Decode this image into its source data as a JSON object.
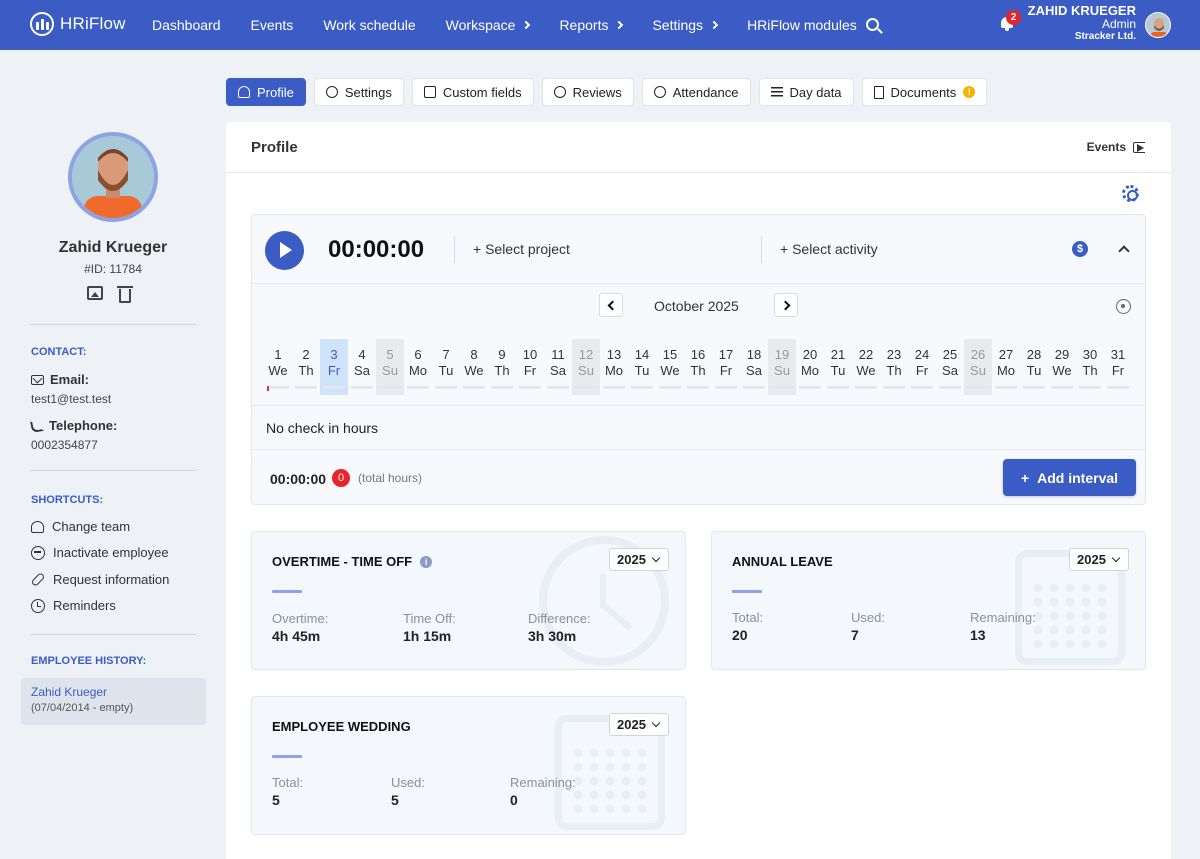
{
  "app": {
    "logo_text": "HRiFlow",
    "nav": [
      {
        "label": "Dashboard",
        "chevron": false
      },
      {
        "label": "Events",
        "chevron": false
      },
      {
        "label": "Work schedule",
        "chevron": false
      },
      {
        "label": "Workspace",
        "chevron": true
      },
      {
        "label": "Reports",
        "chevron": true
      },
      {
        "label": "Settings",
        "chevron": true
      },
      {
        "label": "HRiFlow modules",
        "chevron": false
      }
    ],
    "notifications_count": "2",
    "user": {
      "name": "ZAHID KRUEGER",
      "role": "Admin",
      "company": "Stracker Ltd."
    },
    "accent_color": "#3a5cc4"
  },
  "sidebar": {
    "name": "Zahid Krueger",
    "id_text": "#ID: 11784",
    "contact_title": "CONTACT:",
    "email_label": "Email:",
    "email": "test1@test.test",
    "telephone_label": "Telephone:",
    "telephone": "0002354877",
    "shortcuts_title": "SHORTCUTS:",
    "shortcuts": [
      {
        "label": "Change team",
        "icon": "team-icon"
      },
      {
        "label": "Inactivate employee",
        "icon": "minus-circle-icon"
      },
      {
        "label": "Request information",
        "icon": "link-icon"
      },
      {
        "label": "Reminders",
        "icon": "alarm-icon"
      }
    ],
    "history_title": "EMPLOYEE HISTORY:",
    "history": {
      "name": "Zahid Krueger",
      "range": "(07/04/2014 - empty)"
    }
  },
  "tabs": [
    {
      "label": "Profile",
      "active": true,
      "icon": "user-list-icon"
    },
    {
      "label": "Settings",
      "active": false,
      "icon": "gear-icon"
    },
    {
      "label": "Custom fields",
      "active": false,
      "icon": "pointer-icon"
    },
    {
      "label": "Reviews",
      "active": false,
      "icon": "pie-icon"
    },
    {
      "label": "Attendance",
      "active": false,
      "icon": "clock-icon"
    },
    {
      "label": "Day data",
      "active": false,
      "icon": "list-icon"
    },
    {
      "label": "Documents",
      "active": false,
      "icon": "document-icon",
      "warning": "!"
    }
  ],
  "main": {
    "title": "Profile",
    "events_link": "Events",
    "timer": "00:00:00",
    "select_project": "+ Select project",
    "select_activity": "+ Select activity",
    "currency_symbol": "$",
    "month": "October 2025",
    "days": [
      {
        "n": "1",
        "wd": "We",
        "type": "normal",
        "mark": true
      },
      {
        "n": "2",
        "wd": "Th",
        "type": "normal"
      },
      {
        "n": "3",
        "wd": "Fr",
        "type": "today"
      },
      {
        "n": "4",
        "wd": "Sa",
        "type": "normal"
      },
      {
        "n": "5",
        "wd": "Su",
        "type": "weekend"
      },
      {
        "n": "6",
        "wd": "Mo",
        "type": "normal"
      },
      {
        "n": "7",
        "wd": "Tu",
        "type": "normal"
      },
      {
        "n": "8",
        "wd": "We",
        "type": "normal"
      },
      {
        "n": "9",
        "wd": "Th",
        "type": "normal"
      },
      {
        "n": "10",
        "wd": "Fr",
        "type": "normal"
      },
      {
        "n": "11",
        "wd": "Sa",
        "type": "normal"
      },
      {
        "n": "12",
        "wd": "Su",
        "type": "weekend"
      },
      {
        "n": "13",
        "wd": "Mo",
        "type": "normal"
      },
      {
        "n": "14",
        "wd": "Tu",
        "type": "normal"
      },
      {
        "n": "15",
        "wd": "We",
        "type": "normal"
      },
      {
        "n": "16",
        "wd": "Th",
        "type": "normal"
      },
      {
        "n": "17",
        "wd": "Fr",
        "type": "normal"
      },
      {
        "n": "18",
        "wd": "Sa",
        "type": "normal"
      },
      {
        "n": "19",
        "wd": "Su",
        "type": "weekend"
      },
      {
        "n": "20",
        "wd": "Mo",
        "type": "normal"
      },
      {
        "n": "21",
        "wd": "Tu",
        "type": "normal"
      },
      {
        "n": "22",
        "wd": "We",
        "type": "normal"
      },
      {
        "n": "23",
        "wd": "Th",
        "type": "normal"
      },
      {
        "n": "24",
        "wd": "Fr",
        "type": "normal"
      },
      {
        "n": "25",
        "wd": "Sa",
        "type": "normal"
      },
      {
        "n": "26",
        "wd": "Su",
        "type": "weekend"
      },
      {
        "n": "27",
        "wd": "Mo",
        "type": "normal"
      },
      {
        "n": "28",
        "wd": "Tu",
        "type": "normal"
      },
      {
        "n": "29",
        "wd": "We",
        "type": "normal"
      },
      {
        "n": "30",
        "wd": "Th",
        "type": "normal"
      },
      {
        "n": "31",
        "wd": "Fr",
        "type": "normal"
      }
    ],
    "no_check_in": "No check in hours",
    "total_time": "00:00:00",
    "total_count": "0",
    "total_label": "(total hours)",
    "add_interval": "Add interval"
  },
  "cards": {
    "overtime": {
      "title": "OVERTIME - TIME OFF",
      "year": "2025",
      "items": [
        {
          "k": "Overtime:",
          "v": "4h 45m"
        },
        {
          "k": "Time Off:",
          "v": "1h 15m"
        },
        {
          "k": "Difference:",
          "v": "3h 30m"
        }
      ]
    },
    "annual": {
      "title": "ANNUAL LEAVE",
      "year": "2025",
      "items": [
        {
          "k": "Total:",
          "v": "20"
        },
        {
          "k": "Used:",
          "v": "7"
        },
        {
          "k": "Remaining:",
          "v": "13"
        }
      ]
    },
    "wedding": {
      "title": "EMPLOYEE WEDDING",
      "year": "2025",
      "items": [
        {
          "k": "Total:",
          "v": "5"
        },
        {
          "k": "Used:",
          "v": "5"
        },
        {
          "k": "Remaining:",
          "v": "0"
        }
      ]
    }
  }
}
